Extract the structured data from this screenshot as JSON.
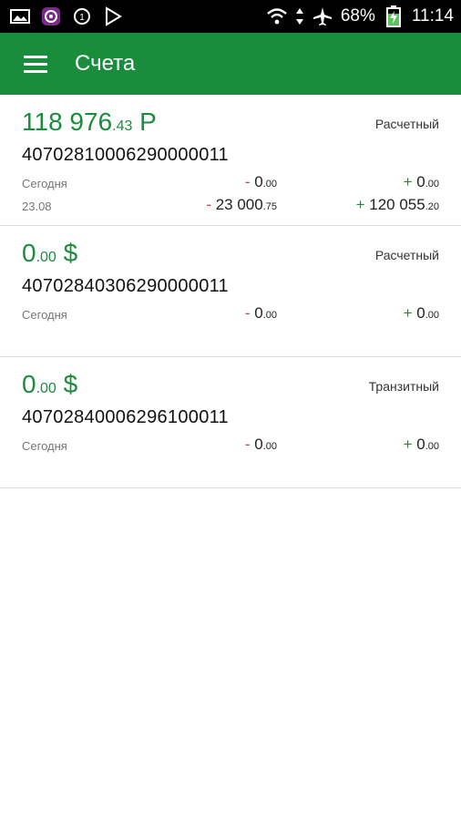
{
  "status_bar": {
    "battery": "68%",
    "time": "11:14"
  },
  "appbar": {
    "title": "Счета"
  },
  "accounts": [
    {
      "balance_main": "118 976",
      "balance_cents": ".43",
      "currency": " Р",
      "type": "Расчетный",
      "number": "40702810006290000011",
      "rows": [
        {
          "label": "Сегодня",
          "debit_sign": "- ",
          "debit_main": "0",
          "debit_cents": ".00",
          "credit_sign": "+ ",
          "credit_main": "0",
          "credit_cents": ".00"
        },
        {
          "label": "23.08",
          "debit_sign": "- ",
          "debit_main": "23 000",
          "debit_cents": ".75",
          "credit_sign": "+ ",
          "credit_main": "120 055",
          "credit_cents": ".20"
        }
      ]
    },
    {
      "balance_main": "0",
      "balance_cents": ".00",
      "currency": " $",
      "type": "Расчетный",
      "number": "40702840306290000011",
      "rows": [
        {
          "label": "Сегодня",
          "debit_sign": "- ",
          "debit_main": "0",
          "debit_cents": ".00",
          "credit_sign": "+ ",
          "credit_main": "0",
          "credit_cents": ".00"
        }
      ]
    },
    {
      "balance_main": "0",
      "balance_cents": ".00",
      "currency": " $",
      "type": "Транзитный",
      "number": "40702840006296100011",
      "rows": [
        {
          "label": "Сегодня",
          "debit_sign": "- ",
          "debit_main": "0",
          "debit_cents": ".00",
          "credit_sign": "+ ",
          "credit_main": "0",
          "credit_cents": ".00"
        }
      ]
    }
  ],
  "colors": {
    "primary": "#1a8d3c",
    "debit": "#d13a3a",
    "credit": "#1a8d3c"
  },
  "icons": [
    "gallery-icon",
    "app-icon",
    "sync-icon",
    "play-store-icon",
    "wifi-icon",
    "data-arrows-icon",
    "airplane-mode-icon",
    "battery-charging-icon",
    "menu-icon"
  ]
}
